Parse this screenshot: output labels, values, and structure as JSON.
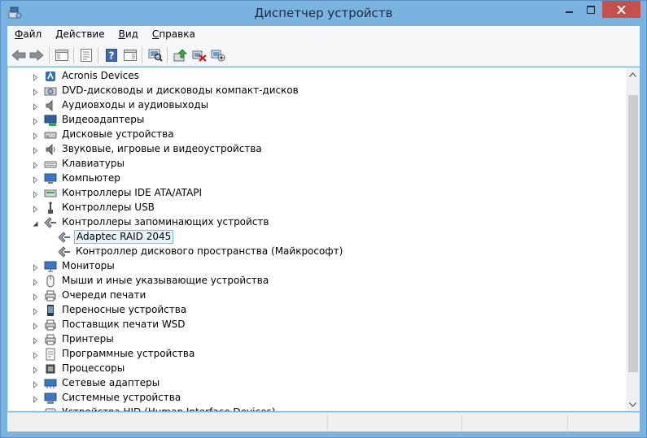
{
  "window": {
    "title": "Диспетчер устройств",
    "controls": {
      "minimize": "minimize",
      "maximize": "maximize",
      "close": "close"
    }
  },
  "menu": [
    {
      "label": "Файл",
      "accel": "Ф",
      "rest": "айл"
    },
    {
      "label": "Действие",
      "accel": "Д",
      "rest": "ействие"
    },
    {
      "label": "Вид",
      "accel": "В",
      "rest": "ид"
    },
    {
      "label": "Справка",
      "accel": "С",
      "rest": "правка"
    }
  ],
  "toolbar": [
    "back-icon",
    "forward-icon",
    "show-hide-console-tree-icon",
    "properties-icon",
    "help-icon",
    "action-pane-icon",
    "scan-hardware-icon",
    "update-driver-icon",
    "uninstall-icon",
    "enable-device-icon"
  ],
  "tree": [
    {
      "label": "Acronis Devices",
      "icon": "acronis-devices-icon",
      "expanded": false
    },
    {
      "label": "DVD-дисководы и дисководы компакт-дисков",
      "icon": "dvd-drive-icon",
      "expanded": false
    },
    {
      "label": "Аудиовходы и аудиовыходы",
      "icon": "speaker-icon",
      "expanded": false
    },
    {
      "label": "Видеоадаптеры",
      "icon": "display-adapter-icon",
      "expanded": false
    },
    {
      "label": "Дисковые устройства",
      "icon": "disk-drive-icon",
      "expanded": false
    },
    {
      "label": "Звуковые, игровые и видеоустройства",
      "icon": "sound-device-icon",
      "expanded": false
    },
    {
      "label": "Клавиатуры",
      "icon": "keyboard-icon",
      "expanded": false
    },
    {
      "label": "Компьютер",
      "icon": "computer-icon",
      "expanded": false
    },
    {
      "label": "Контроллеры IDE ATA/ATAPI",
      "icon": "ide-controller-icon",
      "expanded": false
    },
    {
      "label": "Контроллеры USB",
      "icon": "usb-controller-icon",
      "expanded": false
    },
    {
      "label": "Контроллеры запоминающих устройств",
      "icon": "storage-controller-icon",
      "expanded": true,
      "children": [
        {
          "label": "Adaptec RAID 2045",
          "icon": "storage-controller-icon",
          "selected": true
        },
        {
          "label": "Контроллер дискового пространства (Майкрософт)",
          "icon": "storage-controller-icon",
          "selected": false
        }
      ]
    },
    {
      "label": "Мониторы",
      "icon": "monitor-icon",
      "expanded": false
    },
    {
      "label": "Мыши и иные указывающие устройства",
      "icon": "mouse-icon",
      "expanded": false
    },
    {
      "label": "Очереди печати",
      "icon": "print-queue-icon",
      "expanded": false
    },
    {
      "label": "Переносные устройства",
      "icon": "portable-device-icon",
      "expanded": false
    },
    {
      "label": "Поставщик печати WSD",
      "icon": "wsd-printer-icon",
      "expanded": false
    },
    {
      "label": "Принтеры",
      "icon": "printer-icon",
      "expanded": false
    },
    {
      "label": "Программные устройства",
      "icon": "software-device-icon",
      "expanded": false
    },
    {
      "label": "Процессоры",
      "icon": "processor-icon",
      "expanded": false
    },
    {
      "label": "Сетевые адаптеры",
      "icon": "network-adapter-icon",
      "expanded": false
    },
    {
      "label": "Системные устройства",
      "icon": "system-device-icon",
      "expanded": false
    },
    {
      "label": "Устройства HID (Human Interface Devices)",
      "icon": "hid-icon",
      "expanded": false
    }
  ],
  "colors": {
    "titlebar": "#7ab2e0",
    "close": "#c7504b",
    "selection_bg": "#e5f3fb",
    "selection_border": "#7cbfe8"
  }
}
